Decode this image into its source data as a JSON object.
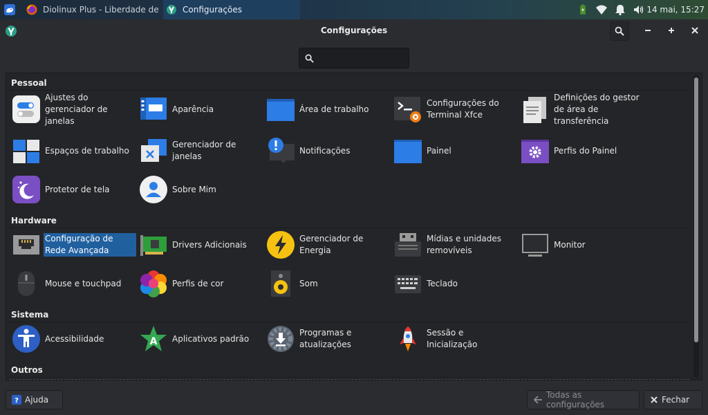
{
  "panel": {
    "tasks": [
      {
        "label": "Diolinux Plus - Liberdade de ..."
      },
      {
        "label": "Configurações"
      }
    ],
    "clock": "14 mai, 15:27"
  },
  "window": {
    "title": "Configurações",
    "search_placeholder": ""
  },
  "categories": {
    "pessoal": "Pessoal",
    "hardware": "Hardware",
    "sistema": "Sistema",
    "outros": "Outros"
  },
  "items": {
    "ajustes": "Ajustes do gerenciador de janelas",
    "aparencia": "Aparência",
    "area": "Área de trabalho",
    "terminal": "Configurações do Terminal Xfce",
    "clipboard": "Definições do gestor de área de transferência",
    "espacos": "Espaços de trabalho",
    "gerenciador_janelas": "Gerenciador de janelas",
    "notificacoes": "Notificações",
    "painel": "Painel",
    "perfis_painel": "Perfis do Painel",
    "protetor": "Protetor de tela",
    "sobre": "Sobre Mim",
    "rede": "Configuração de Rede Avançada",
    "drivers": "Drivers Adicionais",
    "energia": "Gerenciador de Energia",
    "midias": "Mídias e unidades removíveis",
    "monitor": "Monitor",
    "mouse": "Mouse e touchpad",
    "cor": "Perfis de cor",
    "som": "Som",
    "teclado": "Teclado",
    "acessibilidade": "Acessibilidade",
    "aplicativos": "Aplicativos padrão",
    "programas": "Programas e atualizações",
    "sessao": "Sessão e Inicialização"
  },
  "footer": {
    "help": "Ajuda",
    "all_settings": "Todas as configurações",
    "close": "Fechar"
  }
}
